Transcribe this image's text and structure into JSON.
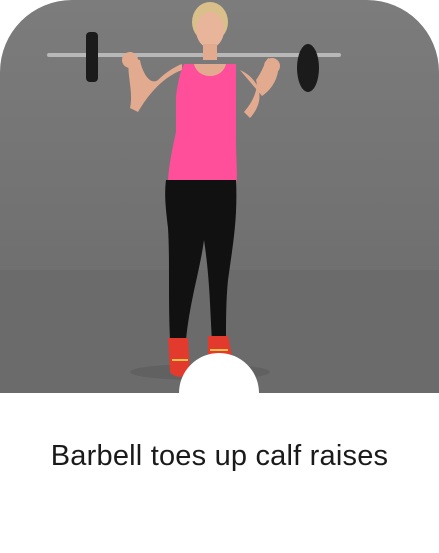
{
  "exercise": {
    "title": "Barbell toes up calf raises",
    "image_icon": "exercise-photo",
    "colors": {
      "background": "#ffffff",
      "title": "#1a1a1a",
      "photo_backdrop": "#767676",
      "tank_top": "#ff4f9a",
      "leggings": "#111111",
      "shoes": "#e23b2e"
    }
  }
}
